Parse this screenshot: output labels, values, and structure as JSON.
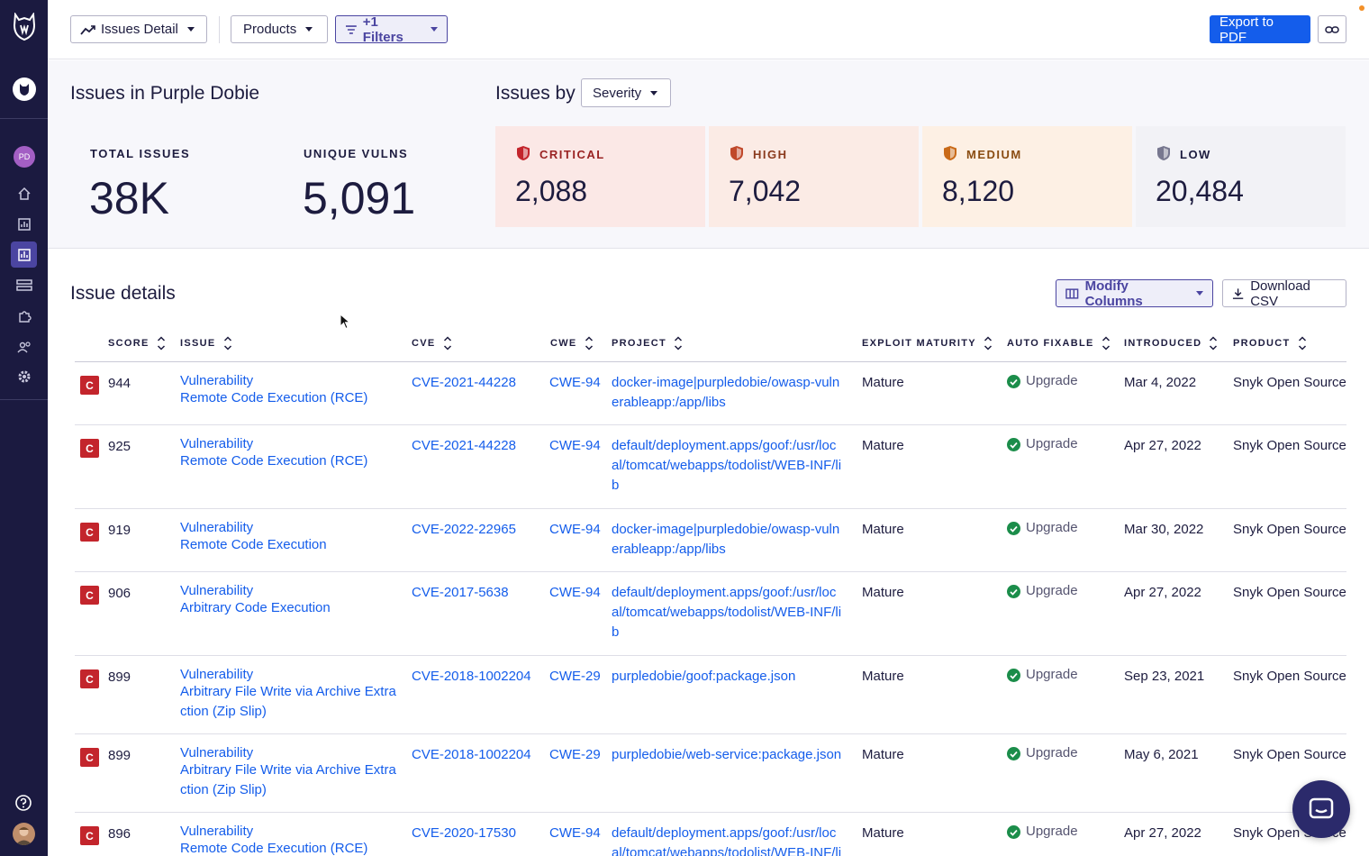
{
  "topbar": {
    "report_label": "Issues Detail",
    "products_label": "Products",
    "filters_label": "+1 Filters",
    "export_label": "Export to PDF"
  },
  "sidebar": {
    "org_initials": "PD"
  },
  "summary": {
    "title": "Issues in Purple Dobie",
    "issues_by_label": "Issues by",
    "group_by_value": "Severity",
    "total_label": "TOTAL ISSUES",
    "total_value": "38K",
    "unique_label": "UNIQUE VULNS",
    "unique_value": "5,091",
    "severities": [
      {
        "label": "CRITICAL",
        "value": "2,088",
        "bg": "#fbe8e6",
        "color": "#9a2323",
        "shield": "#c3252c"
      },
      {
        "label": "HIGH",
        "value": "7,042",
        "bg": "#fbebe5",
        "color": "#8a3a1d",
        "shield": "#c0482a"
      },
      {
        "label": "MEDIUM",
        "value": "8,120",
        "bg": "#fdf0e4",
        "color": "#8a4d12",
        "shield": "#c96a18"
      },
      {
        "label": "LOW",
        "value": "20,484",
        "bg": "#f2f2f6",
        "color": "#1d1c3f",
        "shield": "#77778f"
      }
    ]
  },
  "details": {
    "title": "Issue details",
    "modify_label": "Modify Columns",
    "download_label": "Download CSV",
    "columns": [
      "SCORE",
      "ISSUE",
      "CVE",
      "CWE",
      "PROJECT",
      "EXPLOIT MATURITY",
      "AUTO FIXABLE",
      "INTRODUCED",
      "PRODUCT"
    ],
    "rows": [
      {
        "sev": "C",
        "score": "944",
        "type": "Vulnerability",
        "title1": "Remote Code Execution (RCE)",
        "title2": "",
        "cve": "CVE-2021-44228",
        "cwe": "CWE-94",
        "proj1": "docker-image|purpledobie/owasp-vuln",
        "proj2": "erableapp:/app/libs",
        "proj3": "",
        "maturity": "Mature",
        "fix": "Upgrade",
        "introduced": "Mar 4, 2022",
        "product": "Snyk Open Source"
      },
      {
        "sev": "C",
        "score": "925",
        "type": "Vulnerability",
        "title1": "Remote Code Execution (RCE)",
        "title2": "",
        "cve": "CVE-2021-44228",
        "cwe": "CWE-94",
        "proj1": "default/deployment.apps/goof:/usr/loc",
        "proj2": "al/tomcat/webapps/todolist/WEB-INF/li",
        "proj3": "b",
        "maturity": "Mature",
        "fix": "Upgrade",
        "introduced": "Apr 27, 2022",
        "product": "Snyk Open Source"
      },
      {
        "sev": "C",
        "score": "919",
        "type": "Vulnerability",
        "title1": "Remote Code Execution",
        "title2": "",
        "cve": "CVE-2022-22965",
        "cwe": "CWE-94",
        "proj1": "docker-image|purpledobie/owasp-vuln",
        "proj2": "erableapp:/app/libs",
        "proj3": "",
        "maturity": "Mature",
        "fix": "Upgrade",
        "introduced": "Mar 30, 2022",
        "product": "Snyk Open Source"
      },
      {
        "sev": "C",
        "score": "906",
        "type": "Vulnerability",
        "title1": "Arbitrary Code Execution",
        "title2": "",
        "cve": "CVE-2017-5638",
        "cwe": "CWE-94",
        "proj1": "default/deployment.apps/goof:/usr/loc",
        "proj2": "al/tomcat/webapps/todolist/WEB-INF/li",
        "proj3": "b",
        "maturity": "Mature",
        "fix": "Upgrade",
        "introduced": "Apr 27, 2022",
        "product": "Snyk Open Source"
      },
      {
        "sev": "C",
        "score": "899",
        "type": "Vulnerability",
        "title1": "Arbitrary File Write via Archive Extra",
        "title2": "ction (Zip Slip)",
        "cve": "CVE-2018-1002204",
        "cwe": "CWE-29",
        "proj1": "purpledobie/goof:package.json",
        "proj2": "",
        "proj3": "",
        "maturity": "Mature",
        "fix": "Upgrade",
        "introduced": "Sep 23, 2021",
        "product": "Snyk Open Source"
      },
      {
        "sev": "C",
        "score": "899",
        "type": "Vulnerability",
        "title1": "Arbitrary File Write via Archive Extra",
        "title2": "ction (Zip Slip)",
        "cve": "CVE-2018-1002204",
        "cwe": "CWE-29",
        "proj1": "purpledobie/web-service:package.json",
        "proj2": "",
        "proj3": "",
        "maturity": "Mature",
        "fix": "Upgrade",
        "introduced": "May 6, 2021",
        "product": "Snyk Open Source"
      },
      {
        "sev": "C",
        "score": "896",
        "type": "Vulnerability",
        "title1": "Remote Code Execution (RCE)",
        "title2": "",
        "cve": "CVE-2020-17530",
        "cwe": "CWE-94",
        "proj1": "default/deployment.apps/goof:/usr/loc",
        "proj2": "al/tomcat/webapps/todolist/WEB-INF/li",
        "proj3": "",
        "maturity": "Mature",
        "fix": "Upgrade",
        "introduced": "Apr 27, 2022",
        "product": "Snyk Open Source"
      }
    ]
  }
}
